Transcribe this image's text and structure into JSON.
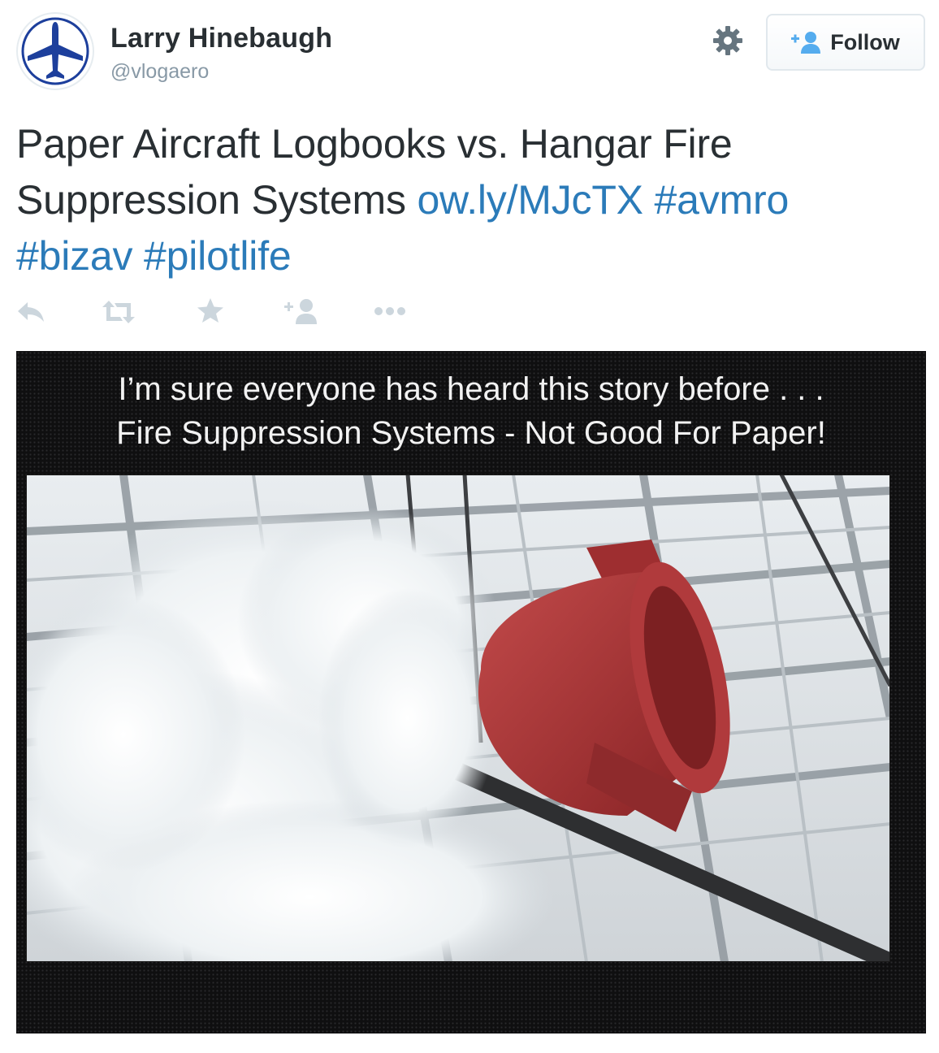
{
  "user": {
    "name": "Larry Hinebaugh",
    "handle": "@vlogaero",
    "avatar_icon": "airplane-icon",
    "brand_color": "#1d3f9c"
  },
  "follow_button": {
    "label": "Follow",
    "icon": "add-user-icon",
    "accent": "#55acee"
  },
  "settings_icon": "gear-icon",
  "tweet": {
    "text_line1": "Paper Aircraft Logbooks vs. Hangar Fire",
    "text_line2": "Suppression Systems ",
    "link": "ow.ly/MJcTX",
    "hashtags": [
      "#avmro",
      "#bizav",
      "#pilotlife"
    ],
    "link_color": "#2b7bb9"
  },
  "actions": [
    {
      "name": "reply",
      "icon": "reply-icon"
    },
    {
      "name": "retweet",
      "icon": "retweet-icon"
    },
    {
      "name": "favorite",
      "icon": "star-icon"
    },
    {
      "name": "follow",
      "icon": "add-user-icon"
    },
    {
      "name": "more",
      "icon": "more-icon"
    }
  ],
  "media": {
    "caption_line1": "I’m sure everyone has heard this story before . . .",
    "caption_line2": "Fire Suppression Systems - Not Good For Paper!"
  }
}
